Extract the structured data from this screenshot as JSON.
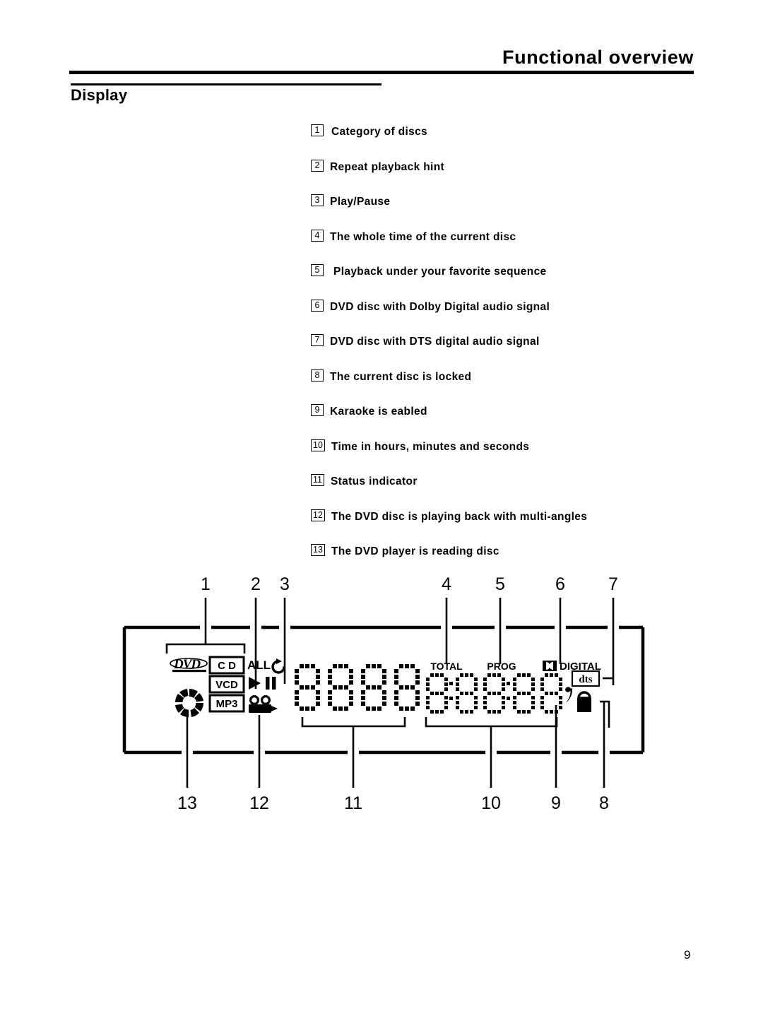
{
  "header": {
    "title": "Functional overview",
    "section": "Display"
  },
  "legend": {
    "items": [
      {
        "num": "1",
        "text": "Category of discs"
      },
      {
        "num": "2",
        "text": "Repeat playback hint"
      },
      {
        "num": "3",
        "text": "Play/Pause"
      },
      {
        "num": "4",
        "text": "The whole time of the current disc"
      },
      {
        "num": "5",
        "text": "Playback under your favorite sequence"
      },
      {
        "num": "6",
        "text": "DVD disc with Dolby Digital audio signal"
      },
      {
        "num": "7",
        "text": "DVD disc with DTS digital audio signal"
      },
      {
        "num": "8",
        "text": "The current disc is locked"
      },
      {
        "num": "9",
        "text": "Karaoke is eabled"
      },
      {
        "num": "10",
        "text": "Time in hours, minutes and seconds"
      },
      {
        "num": "11",
        "text": "Status indicator"
      },
      {
        "num": "12",
        "text": "The DVD disc is playing back with multi-angles"
      },
      {
        "num": "13",
        "text": "The DVD player is reading disc"
      }
    ]
  },
  "diagram": {
    "callouts_top": [
      "1",
      "2",
      "3",
      "4",
      "5",
      "6",
      "7"
    ],
    "callouts_bottom": [
      "13",
      "12",
      "11",
      "10",
      "9",
      "8"
    ],
    "panel_labels": {
      "dvd": "DVD",
      "cd": "C D",
      "vcd": "VCD",
      "mp3": "MP3",
      "all": "ALL",
      "total": "TOTAL",
      "prog": "PROG",
      "digital": "DIGITAL",
      "dts": "dts"
    },
    "icon_names": [
      "dvd-logo-icon",
      "disc-spinner-icon",
      "cd-badge-icon",
      "vcd-badge-icon",
      "mp3-badge-icon",
      "repeat-all-icon",
      "play-pause-icon",
      "multi-angle-camera-icon",
      "dolby-digital-icon",
      "dts-badge-icon",
      "lock-icon",
      "karaoke-note-icon",
      "segment-display-icon"
    ]
  },
  "footer": {
    "page_number": "9"
  },
  "colors": {
    "ink": "#000000",
    "paper": "#ffffff"
  }
}
